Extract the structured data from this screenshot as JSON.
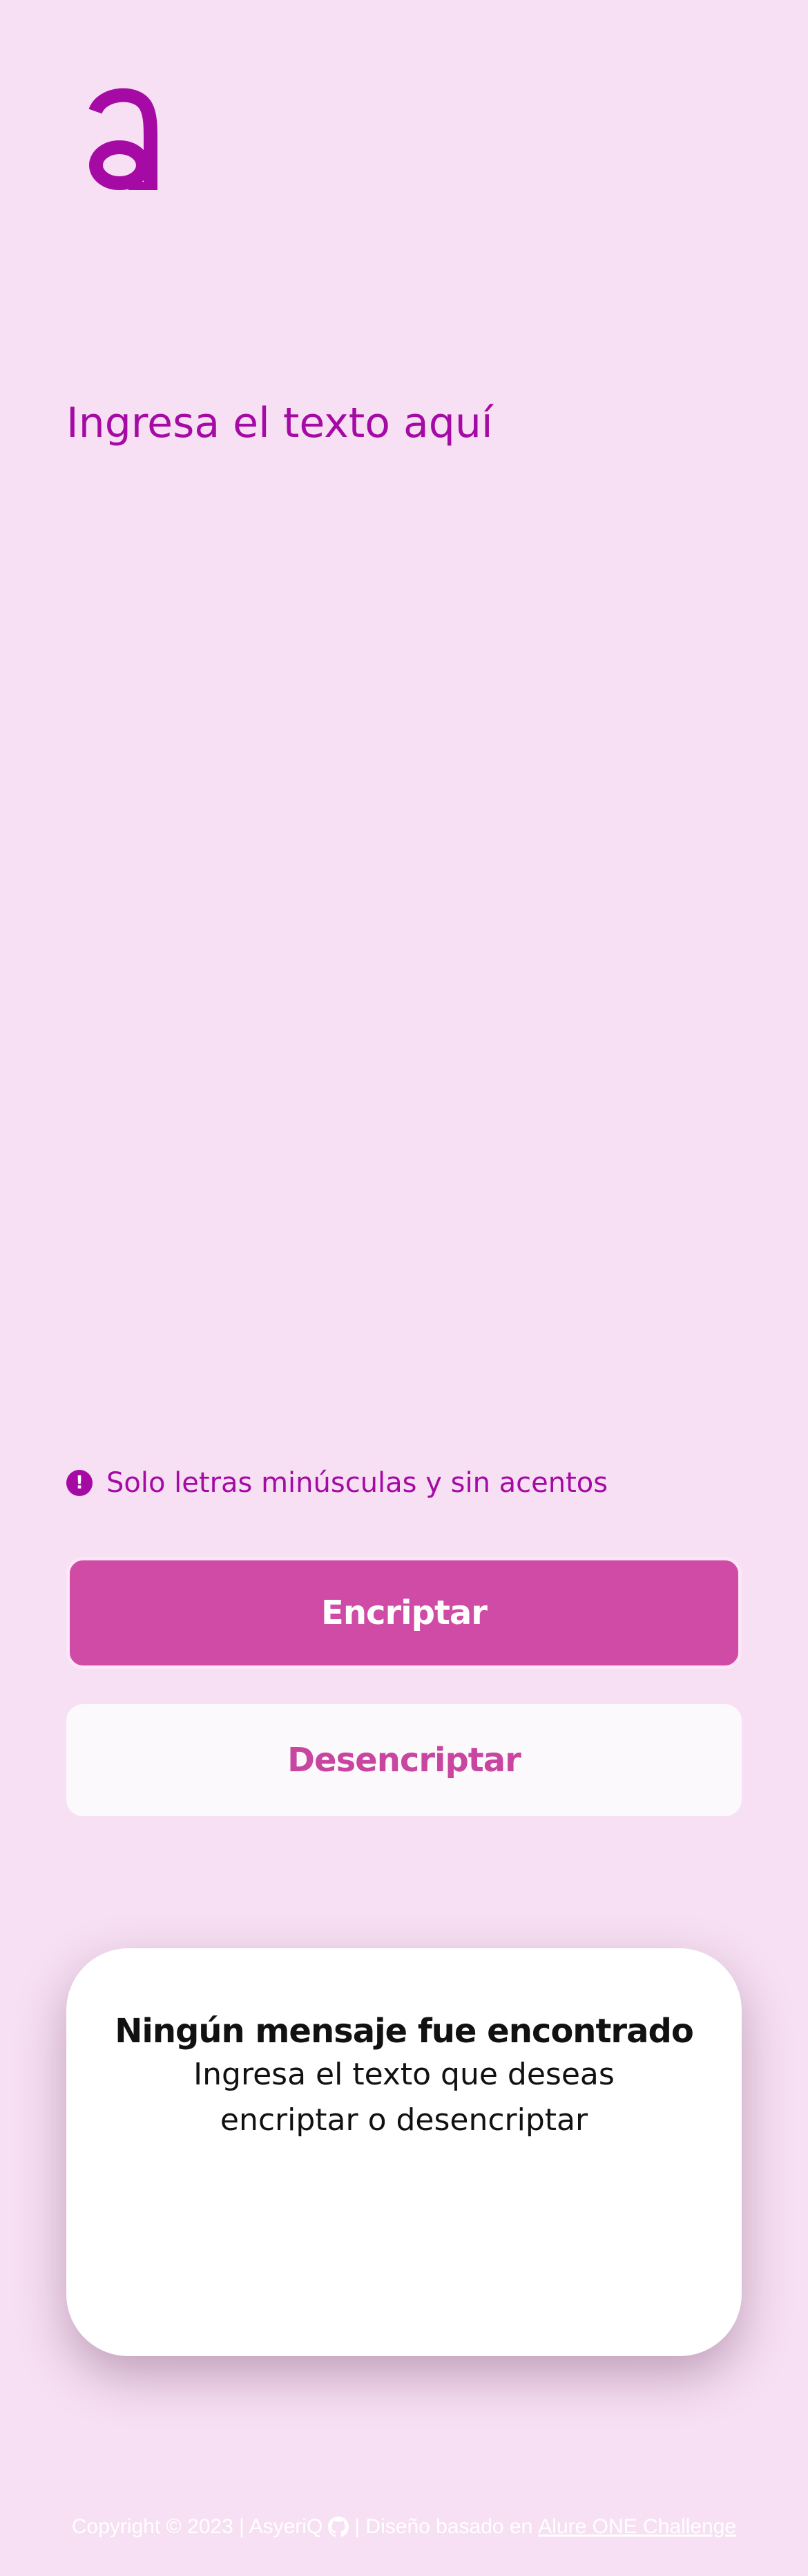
{
  "brand": {
    "logo_letter": "a",
    "accent_color": "#a50aa5"
  },
  "input": {
    "placeholder": "Ingresa el texto aquí",
    "value": ""
  },
  "hint": {
    "icon": "exclamation-circle-icon",
    "text": "Solo letras minúsculas y sin acentos"
  },
  "actions": {
    "encrypt_label": "Encriptar",
    "decrypt_label": "Desencriptar"
  },
  "result": {
    "title": "Ningún mensaje fue encontrado",
    "subtitle": "Ingresa el texto que deseas encriptar o desencriptar"
  },
  "footer": {
    "copyright": "Copyright © 2023 | AsyeriQ",
    "github_icon": "github-icon",
    "based_on": "| Diseño basado en",
    "link_text": "Alure ONE Challenge"
  },
  "colors": {
    "background": "#f7e0f3",
    "primary_button": "#d04ba5",
    "secondary_button": "#fbf9fb"
  }
}
